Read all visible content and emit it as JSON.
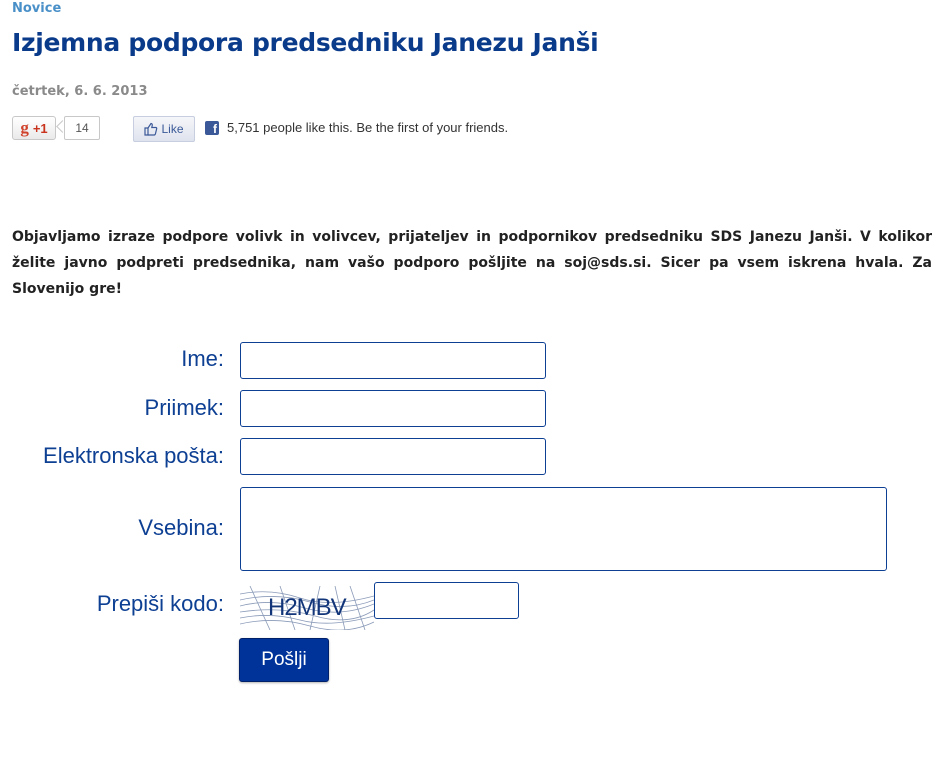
{
  "article": {
    "category": "Novice",
    "title": "Izjemna podpora predsedniku Janezu Janši",
    "date": "četrtek, 6. 6. 2013",
    "intro": "Objavljamo izraze podpore volivk in volivcev, prijateljev in podpornikov predsedniku SDS Janezu Janši. V kolikor želite javno podpreti predsednika, nam vašo podporo pošljite na soj@sds.si. Sicer pa vsem iskrena hvala. Za Slovenijo gre!"
  },
  "social": {
    "gplus_label": "+1",
    "gplus_g": "g",
    "gplus_count": "14",
    "fb_like_label": "Like",
    "fb_logo": "f",
    "fb_text": "5,751 people like this. Be the first of your friends."
  },
  "form": {
    "name_label": "Ime:",
    "name_value": "",
    "surname_label": "Priimek:",
    "surname_value": "",
    "email_label": "Elektronska pošta:",
    "email_value": "",
    "content_label": "Vsebina:",
    "content_value": "",
    "captcha_label": "Prepiši kodo:",
    "captcha_code": "H2MBV",
    "captcha_value": "",
    "submit_label": "Pošlji"
  },
  "colors": {
    "title": "#0a3a8a",
    "category": "#4a90c8",
    "form_label": "#0d3f93",
    "button": "#00339a"
  },
  "icons": {
    "gplus": "google-plus-icon",
    "fb_thumb": "thumbs-up-icon",
    "fb_logo": "facebook-icon"
  }
}
